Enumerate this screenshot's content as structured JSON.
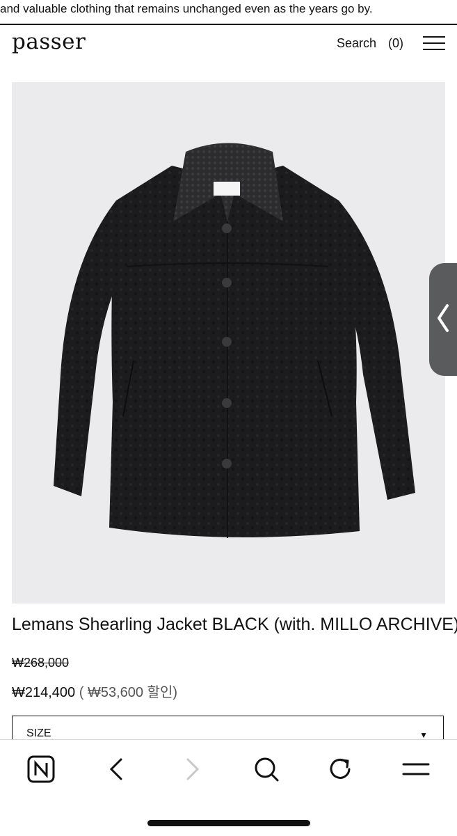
{
  "marquee": {
    "text": "and valuable clothing that remains unchanged even as the years go by."
  },
  "header": {
    "logo": "passer",
    "search_label": "Search",
    "cart_label": "(0)",
    "menu_icon": "hamburger-menu-icon"
  },
  "product": {
    "image_alt": "Black shearling jacket",
    "title": "Lemans Shearling Jacket BLACK (with. MILLO ARCHIVE)",
    "original_price": "₩268,000",
    "sale_price": "₩214,400",
    "discount_text": "( ₩53,600 할인)",
    "size_label": "SIZE"
  },
  "browser_toolbar": {
    "buttons": [
      "naver-home-icon",
      "back-icon",
      "forward-icon",
      "search-icon",
      "reload-icon",
      "menu-icon"
    ]
  },
  "colors": {
    "text": "#111111",
    "image_bg": "#ebebed",
    "side_tab": "#5a5b5d",
    "disabled": "#c8c8c8"
  }
}
